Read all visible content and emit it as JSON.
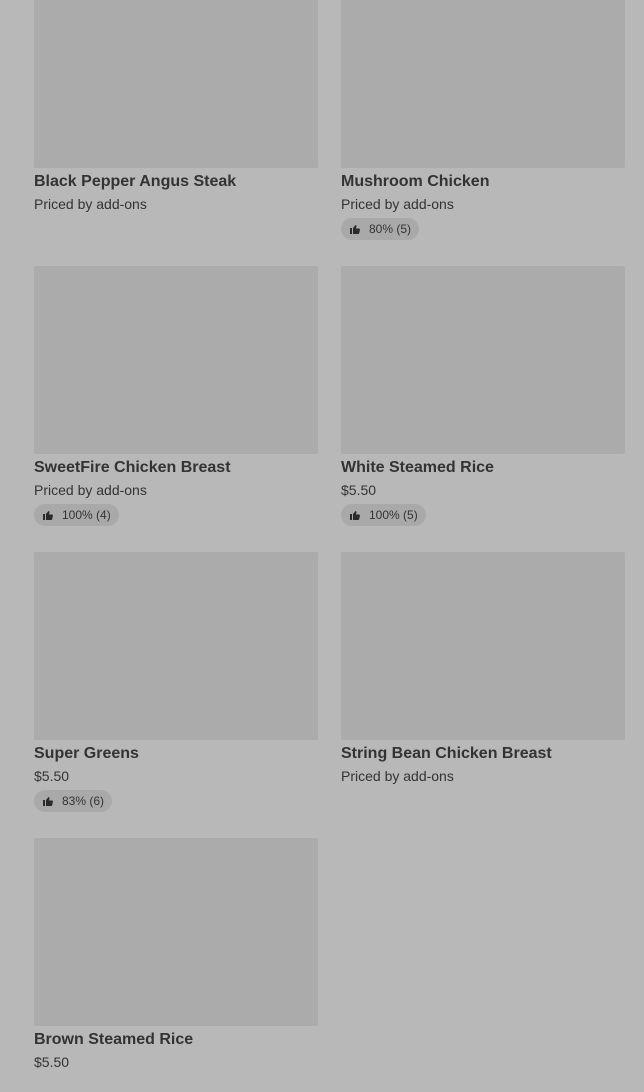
{
  "items": [
    {
      "name": "Black Pepper Angus Steak",
      "price": "Priced by add-ons",
      "rating": ""
    },
    {
      "name": "Mushroom Chicken",
      "price": "Priced by add-ons",
      "rating": "80% (5)"
    },
    {
      "name": "SweetFire Chicken Breast",
      "price": "Priced by add-ons",
      "rating": "100% (4)"
    },
    {
      "name": "White Steamed Rice",
      "price": "$5.50",
      "rating": "100% (5)"
    },
    {
      "name": "Super Greens",
      "price": "$5.50",
      "rating": "83% (6)"
    },
    {
      "name": "String Bean Chicken Breast",
      "price": "Priced by add-ons",
      "rating": ""
    },
    {
      "name": "Brown Steamed Rice",
      "price": "$5.50",
      "rating": ""
    }
  ],
  "icons": {
    "rating": "thumbs-up-icon"
  }
}
